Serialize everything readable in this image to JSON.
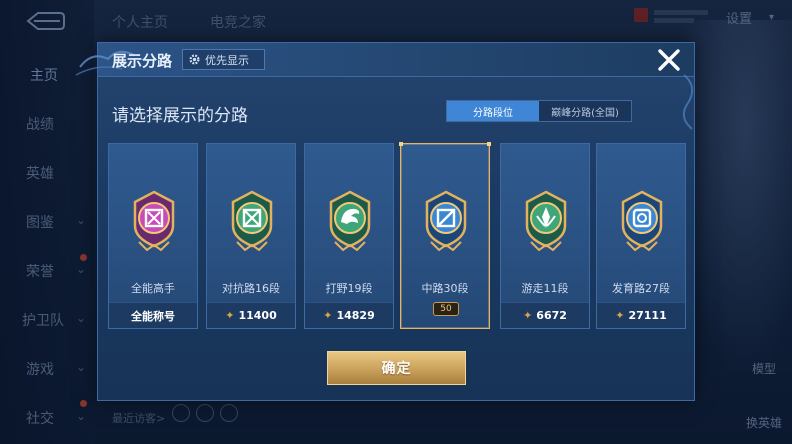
{
  "background": {
    "top_tabs": [
      "个人主页",
      "电竞之家"
    ],
    "settings_label": "设置",
    "sidebar": [
      {
        "label": "主页",
        "has_chevron": false,
        "active": true
      },
      {
        "label": "战绩",
        "has_chevron": false
      },
      {
        "label": "英雄",
        "has_chevron": false
      },
      {
        "label": "图鉴",
        "has_chevron": true
      },
      {
        "label": "荣誉",
        "has_chevron": true
      },
      {
        "label": "护卫队",
        "has_chevron": true
      },
      {
        "label": "游戏",
        "has_chevron": true
      },
      {
        "label": "社交",
        "has_chevron": true
      }
    ],
    "recent_visitors_label": "最近访客>",
    "hero_model_label": "模型",
    "change_hero_label": "换英雄"
  },
  "dialog": {
    "title": "展示分路",
    "priority_button": {
      "label": "优先显示",
      "icon": "gear-icon"
    },
    "prompt": "请选择展示的分路",
    "toggle": {
      "options": [
        "分路段位",
        "巅峰分路(全国)"
      ],
      "selected_index": 0
    },
    "cards": [
      {
        "role": "全能高手",
        "footer_text": "全能称号",
        "score": null,
        "badge": "all-round-badge",
        "color": "#c94bb8",
        "selected": false
      },
      {
        "role": "对抗路16段",
        "footer_text": "11400",
        "score": 11400,
        "badge": "clash-lane-badge",
        "color": "#3fa67a",
        "selected": false
      },
      {
        "role": "打野19段",
        "footer_text": "14829",
        "score": 14829,
        "badge": "jungle-badge",
        "color": "#3fa67a",
        "selected": false
      },
      {
        "role": "中路30段",
        "footer_text": "",
        "score": null,
        "level_pill": "50",
        "badge": "mid-lane-badge",
        "color": "#3a87d3",
        "selected": true
      },
      {
        "role": "游走11段",
        "footer_text": "6672",
        "score": 6672,
        "badge": "roam-badge",
        "color": "#3fa67a",
        "selected": false
      },
      {
        "role": "发育路27段",
        "footer_text": "27111",
        "score": 27111,
        "badge": "farm-lane-badge",
        "color": "#3a87d3",
        "selected": false
      }
    ],
    "confirm_label": "确定",
    "colors": {
      "accent_blue": "#3f86d6",
      "gold": "#caa05a",
      "selected_border": "#e3b66a"
    }
  }
}
